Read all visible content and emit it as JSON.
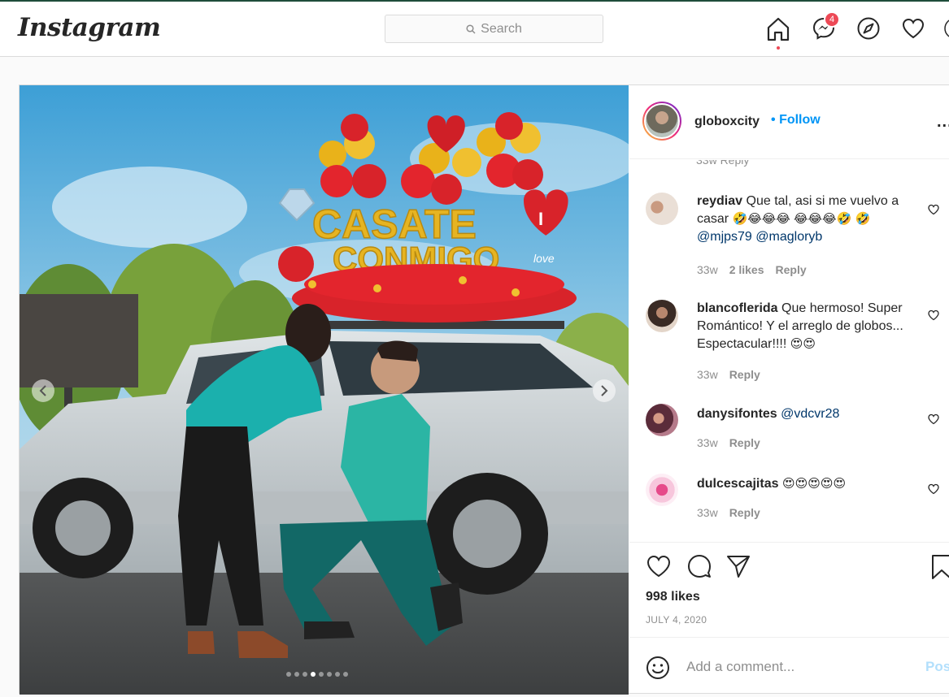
{
  "header": {
    "logo": "Instagram",
    "search_placeholder": "Search",
    "messages_badge": "4",
    "icons": [
      "home-icon",
      "messenger-icon",
      "explore-icon",
      "heart-icon"
    ]
  },
  "post": {
    "username": "globoxcity",
    "follow_label": "Follow",
    "separator": "•",
    "more_label": "...",
    "stub_meta": "33w   Reply",
    "carousel_dots": 8,
    "carousel_active": 3,
    "comments": [
      {
        "user": "reydiav",
        "text": "Que tal, asi si me vuelvo a casar",
        "emojis_line1": "🤣😂😂😂 😂😂😂🤣",
        "emojis_line2": "🤣",
        "mentions": [
          "@mjps79",
          "@magloryb"
        ],
        "time": "33w",
        "likes": "2 likes",
        "reply": "Reply"
      },
      {
        "user": "blancoflerida",
        "text_l1": "Que hermoso!",
        "text_l2": "Super Romántico! Y el arreglo de",
        "text_l3": "globos... Espectacular!!!! ",
        "emojis": "😍😍",
        "time": "33w",
        "reply": "Reply"
      },
      {
        "user": "danysifontes",
        "mention": "@vdcvr28",
        "time": "33w",
        "reply": "Reply"
      },
      {
        "user": "dulcescajitas",
        "emojis": "😍😍😍😍😍",
        "time": "33w",
        "reply": "Reply"
      }
    ],
    "likes": "998 likes",
    "date": "JULY 4, 2020",
    "add_comment_placeholder": "Add a comment...",
    "post_label": "Post"
  },
  "photo": {
    "sign_line1": "CASATE",
    "sign_line2": "CONMIGO",
    "heart_text": "I",
    "love_text": "love"
  },
  "colors": {
    "accent": "#0095f6",
    "badge": "#ed4956",
    "text": "#262626",
    "muted": "#8e8e8e"
  }
}
